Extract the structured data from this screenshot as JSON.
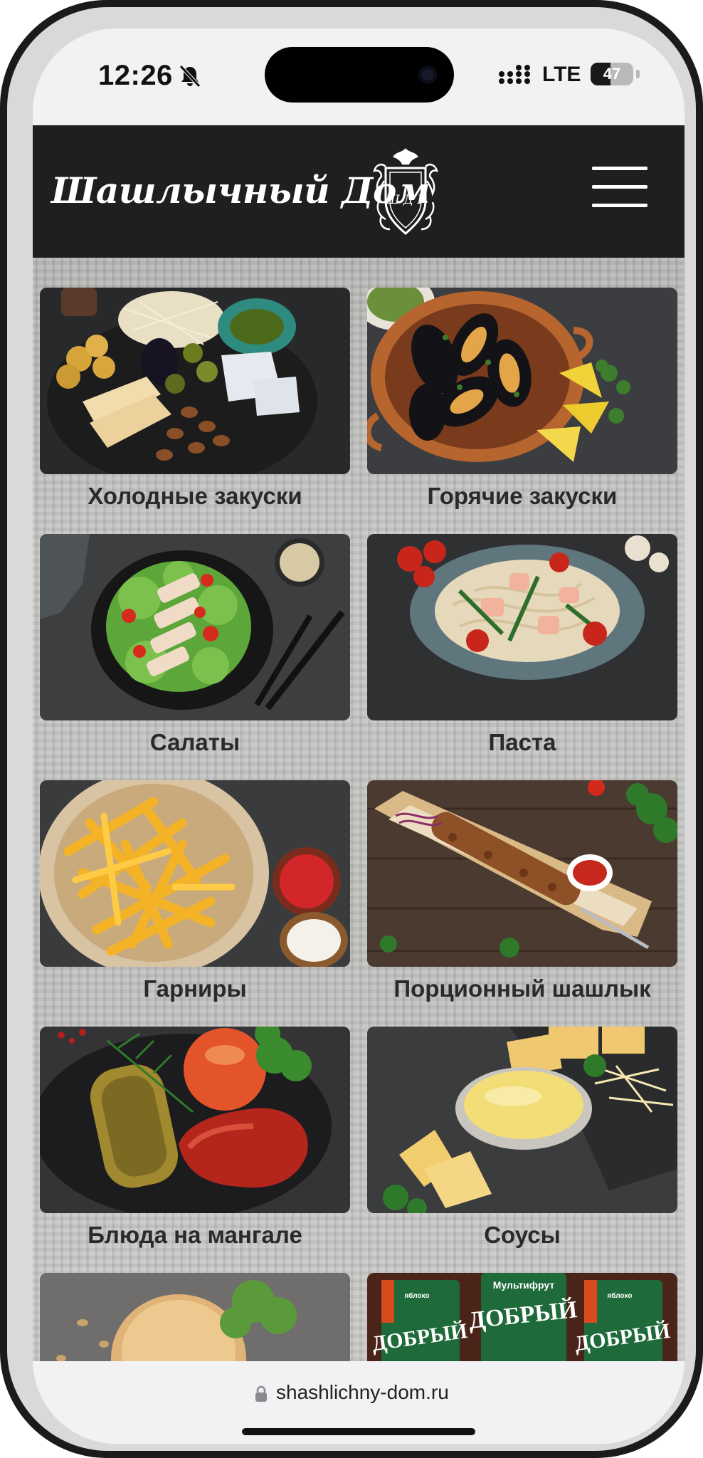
{
  "status_bar": {
    "time": "12:26",
    "network": "LTE",
    "battery": "47",
    "battery_level": 0.47
  },
  "header": {
    "logo_text": "Шашлычный Дом",
    "crest_letters": "Ш Д Г",
    "menu_icon": "hamburger-icon"
  },
  "categories": [
    {
      "title": "Холодные закуски"
    },
    {
      "title": "Горячие закуски"
    },
    {
      "title": "Салаты"
    },
    {
      "title": "Паста"
    },
    {
      "title": "Гарниры"
    },
    {
      "title": "Порционный шашлык"
    },
    {
      "title": "Блюда на мангале"
    },
    {
      "title": "Соусы"
    },
    {
      "title": ""
    },
    {
      "title": "",
      "image_text": [
        "Мультифрут",
        "ДОБРЫЙ",
        "ДОБРЫЙ",
        "ДОБРЫЙ",
        "яблоко",
        "яблоко"
      ]
    }
  ],
  "address_bar": {
    "url": "shashlichny-dom.ru"
  },
  "colors": {
    "header_bg": "#1f1f1f",
    "title_text": "#2a2a2a",
    "page_bg": "#bdbdbb"
  }
}
